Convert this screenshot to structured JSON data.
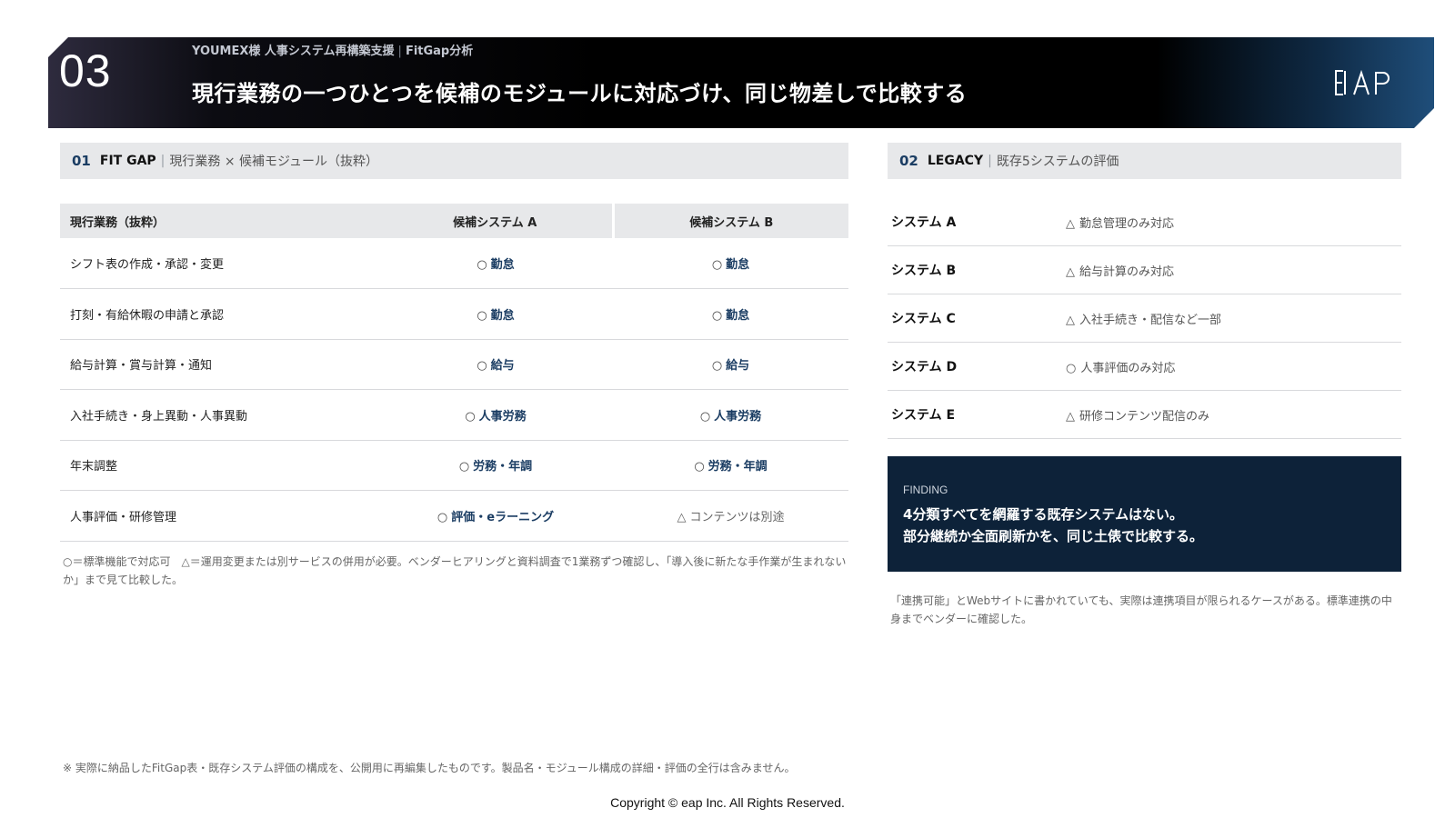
{
  "header": {
    "section_number": "03",
    "client_project": "YOUMEX様 人事システム再構築支援",
    "separator": "|",
    "analysis_label": "FitGap分析",
    "title": "現行業務の一つひとつを候補のモジュールに対応づけ、同じ物差しで比較する",
    "logo_text": "EAP"
  },
  "fitgap_panel": {
    "number": "01",
    "title": "FIT GAP",
    "separator": "|",
    "description": "現行業務 × 候補モジュール（抜粋）",
    "columns": [
      "現行業務（抜粋）",
      "候補システム A",
      "候補システム B"
    ],
    "rows": [
      {
        "task": "シフト表の作成・承認・変更",
        "a_mark": "○",
        "a_text": "勤怠",
        "a_status": "ok",
        "b_mark": "○",
        "b_text": "勤怠",
        "b_status": "ok"
      },
      {
        "task": "打刻・有給休暇の申請と承認",
        "a_mark": "○",
        "a_text": "勤怠",
        "a_status": "ok",
        "b_mark": "○",
        "b_text": "勤怠",
        "b_status": "ok"
      },
      {
        "task": "給与計算・賞与計算・通知",
        "a_mark": "○",
        "a_text": "給与",
        "a_status": "ok",
        "b_mark": "○",
        "b_text": "給与",
        "b_status": "ok"
      },
      {
        "task": "入社手続き・身上異動・人事異動",
        "a_mark": "○",
        "a_text": "人事労務",
        "a_status": "ok",
        "b_mark": "○",
        "b_text": "人事労務",
        "b_status": "ok"
      },
      {
        "task": "年末調整",
        "a_mark": "○",
        "a_text": "労務・年調",
        "a_status": "ok",
        "b_mark": "○",
        "b_text": "労務・年調",
        "b_status": "ok"
      },
      {
        "task": "人事評価・研修管理",
        "a_mark": "○",
        "a_text": "評価・eラーニング",
        "a_status": "ok",
        "b_mark": "△",
        "b_text": "コンテンツは別途",
        "b_status": "partial"
      }
    ],
    "note": "○＝標準機能で対応可　△＝運用変更または別サービスの併用が必要。ベンダーヒアリングと資料調査で1業務ずつ確認し、「導入後に新たな手作業が生まれないか」まで見て比較した。"
  },
  "legacy_panel": {
    "number": "02",
    "title": "LEGACY",
    "separator": "|",
    "description": "既存5システムの評価",
    "systems": [
      {
        "name": "システム A",
        "mark": "△",
        "evaluation": "勤怠管理のみ対応"
      },
      {
        "name": "システム B",
        "mark": "△",
        "evaluation": "給与計算のみ対応"
      },
      {
        "name": "システム C",
        "mark": "△",
        "evaluation": "入社手続き・配信など一部"
      },
      {
        "name": "システム D",
        "mark": "○",
        "evaluation": "人事評価のみ対応"
      },
      {
        "name": "システム E",
        "mark": "△",
        "evaluation": "研修コンテンツ配信のみ"
      }
    ],
    "finding": {
      "label": "FINDING",
      "line1": "4分類すべてを網羅する既存システムはない。",
      "line2": "部分継続か全面刷新かを、同じ土俵で比較する。"
    },
    "note": "「連携可能」とWebサイトに書かれていても、実際は連携項目が限られるケースがある。標準連携の中身までベンダーに確認した。"
  },
  "footer": {
    "disclaimer": "※ 実際に納品したFitGap表・既存システム評価の構成を、公開用に再編集したものです。製品名・モジュール構成の詳細・評価の全行は含みません。",
    "copyright": "Copyright © eap Inc. All Rights Reserved."
  },
  "colors": {
    "navy": "#1b3d63",
    "finding_bg": "#0d2239",
    "panel_header_bg": "#e7e8ea"
  }
}
